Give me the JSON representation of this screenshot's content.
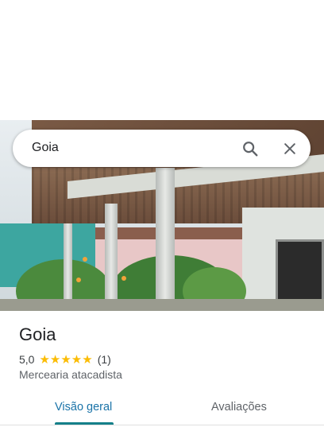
{
  "search": {
    "query": "Goia"
  },
  "place": {
    "name": "Goia",
    "rating": "5,0",
    "stars": "★★★★★",
    "review_count": "(1)",
    "category": "Mercearia atacadista"
  },
  "tabs": [
    {
      "label": "Visão geral",
      "active": true
    },
    {
      "label": "Avaliações",
      "active": false
    }
  ],
  "colors": {
    "accent": "#15808a",
    "star": "#fbbc04"
  },
  "icons": [
    "search-icon",
    "close-icon"
  ]
}
